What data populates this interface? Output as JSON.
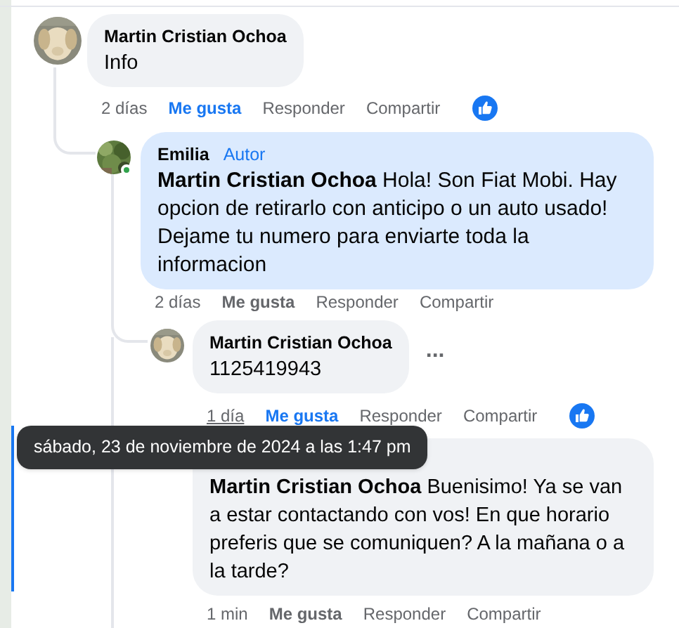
{
  "comments": [
    {
      "author": "Martin Cristian Ochoa",
      "avatar": true,
      "online": false,
      "highlighted": false,
      "text": "Info",
      "time": "2 días",
      "time_hovered": false,
      "like": "Me gusta",
      "liked": true,
      "reply": "Responder",
      "share": "Compartir",
      "reacted": true
    },
    {
      "author": "Emilia",
      "badge": "Autor",
      "avatar": true,
      "online": true,
      "highlighted": true,
      "text": "**Martin Cristian Ochoa** Hola! Son Fiat Mobi. Hay opcion de retirarlo con anticipo o un auto usado! Dejame tu numero para enviarte toda la informacion",
      "time": "2 días",
      "time_hovered": false,
      "like": "Me gusta",
      "liked": false,
      "reply": "Responder",
      "share": "Compartir",
      "reacted": false
    },
    {
      "author": "Martin Cristian Ochoa",
      "avatar": true,
      "online": false,
      "highlighted": false,
      "text": "1125419943",
      "menu": "...",
      "time": "1 día",
      "time_hovered": true,
      "like": "Me gusta",
      "liked": true,
      "reply": "Responder",
      "share": "Compartir",
      "reacted": true
    },
    {
      "avatar": false,
      "online": false,
      "highlighted": false,
      "text": "**Martin Cristian Ochoa** Buenisimo! Ya se van a estar contactando con vos! En que horario preferis que se comuniquen? A la mañana o a la tarde?",
      "time": "1 min",
      "time_hovered": false,
      "like": "Me gusta",
      "liked": false,
      "reply": "Responder",
      "share": "Compartir",
      "reacted": false
    }
  ],
  "tooltip": {
    "text": "sábado, 23 de noviembre de 2024 a las 1:47 pm"
  }
}
